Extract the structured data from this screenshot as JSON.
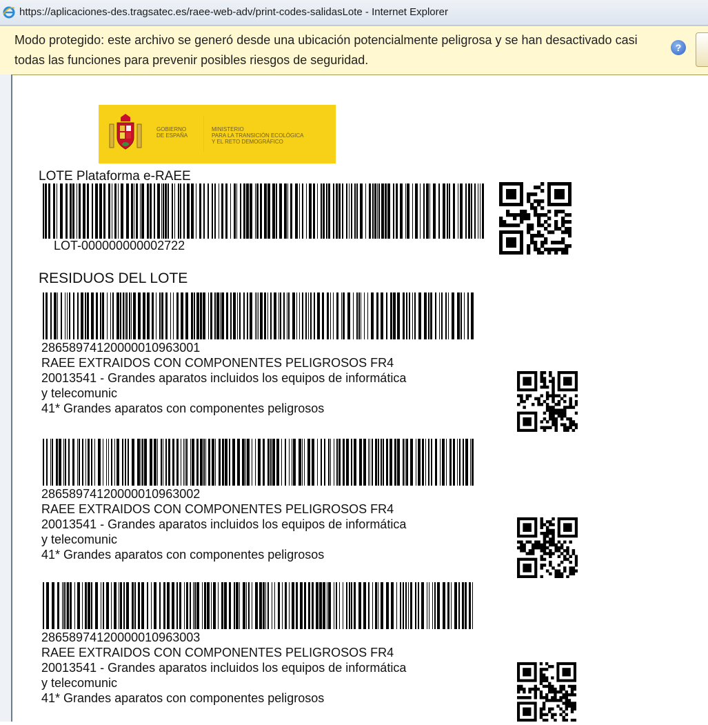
{
  "window": {
    "title": "https://aplicaciones-des.tragsatec.es/raee-web-adv/print-codes-salidasLote - Internet Explorer"
  },
  "infobar": {
    "text": "Modo protegido: este archivo se generó desde una ubicación potencialmente peligrosa y se han desactivado casi todas las funciones para prevenir posibles riesgos de seguridad.",
    "help_symbol": "?"
  },
  "logo": {
    "gobierno_line1": "GOBIERNO",
    "gobierno_line2": "DE ESPAÑA",
    "ministerio_line1": "MINISTERIO",
    "ministerio_line2": "PARA LA TRANSICIÓN ECOLÓGICA",
    "ministerio_line3": "Y EL RETO DEMOGRÁFICO"
  },
  "lote": {
    "label": "LOTE Plataforma e-RAEE",
    "code": "LOT-000000000002722"
  },
  "residuos": {
    "title": "RESIDUOS DEL LOTE",
    "items": [
      {
        "code": "28658974120000010963001",
        "name": "RAEE EXTRAIDOS CON COMPONENTES PELIGROSOS FR4",
        "ler_line1": "20013541 - Grandes aparatos incluidos los equipos de informática",
        "ler_line2": "y telecomunic",
        "category": "41* Grandes aparatos con componentes peligrosos"
      },
      {
        "code": "28658974120000010963002",
        "name": "RAEE EXTRAIDOS CON COMPONENTES PELIGROSOS FR4",
        "ler_line1": "20013541 - Grandes aparatos incluidos los equipos de informática",
        "ler_line2": "y telecomunic",
        "category": "41* Grandes aparatos con componentes peligrosos"
      },
      {
        "code": "28658974120000010963003",
        "name": "RAEE EXTRAIDOS CON COMPONENTES PELIGROSOS FR4",
        "ler_line1": "20013541 - Grandes aparatos incluidos los equipos de informática",
        "ler_line2": "y telecomunic",
        "category": "41* Grandes aparatos con componentes peligrosos"
      }
    ]
  },
  "icons": {
    "browser": "internet-explorer-icon",
    "help": "help-icon",
    "barcode": "barcode-icon",
    "qr": "qr-code-icon",
    "shield": "coat-of-arms-icon"
  },
  "colors": {
    "logo_yellow": "#f7d117",
    "infobar": "#fff8d0"
  }
}
